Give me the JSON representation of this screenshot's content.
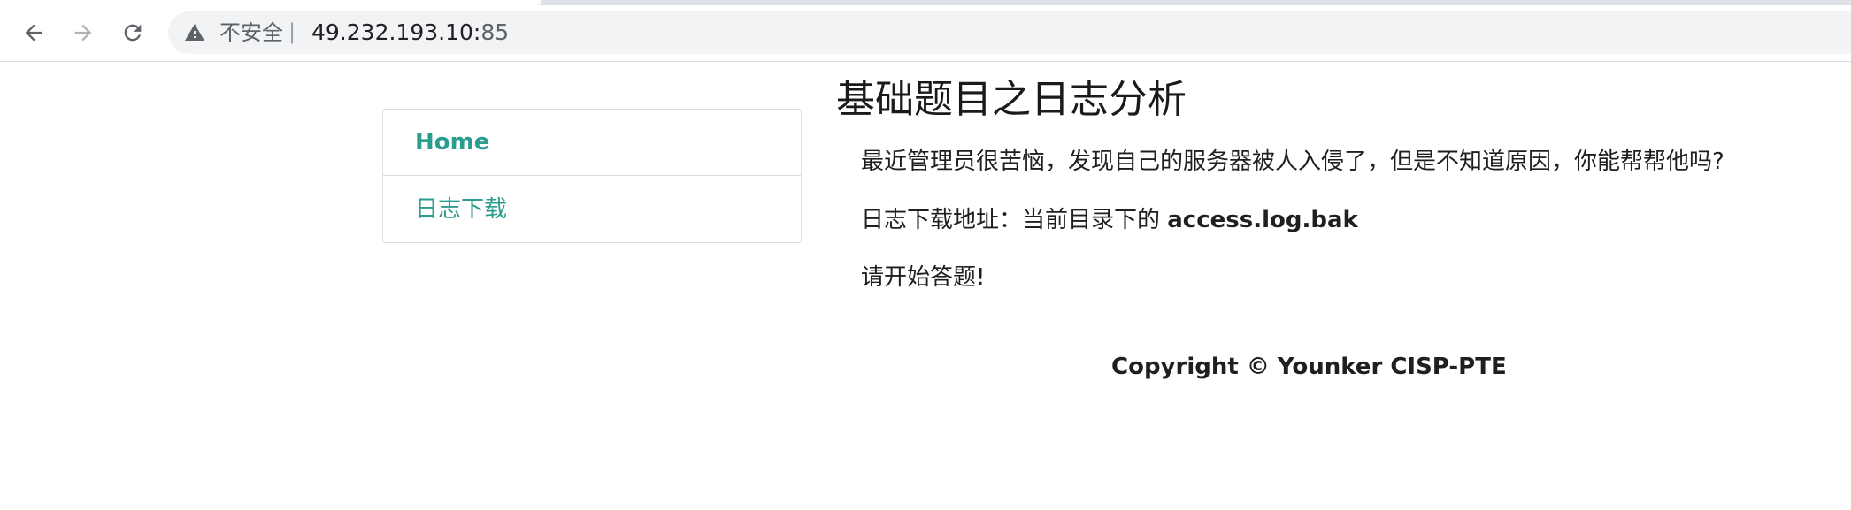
{
  "browser": {
    "security_label": "不安全",
    "separator": "|",
    "url_host": "49.232.193.10:",
    "url_port": "85",
    "icons": [
      "back-arrow-icon",
      "forward-arrow-icon",
      "reload-icon",
      "warning-icon"
    ]
  },
  "sidebar": {
    "items": [
      {
        "label": "Home"
      },
      {
        "label": "日志下载"
      }
    ],
    "accent_color": "#2a9d8f"
  },
  "main": {
    "title": "基础题目之日志分析",
    "paragraph1": "最近管理员很苦恼，发现自己的服务器被人入侵了，但是不知道原因，你能帮帮他吗?",
    "paragraph2_prefix": "日志下载地址：当前目录下的 ",
    "paragraph2_file": "access.log.bak",
    "paragraph3": "请开始答题!"
  },
  "footer": {
    "copyright": "Copyright © Younker CISP-PTE"
  }
}
